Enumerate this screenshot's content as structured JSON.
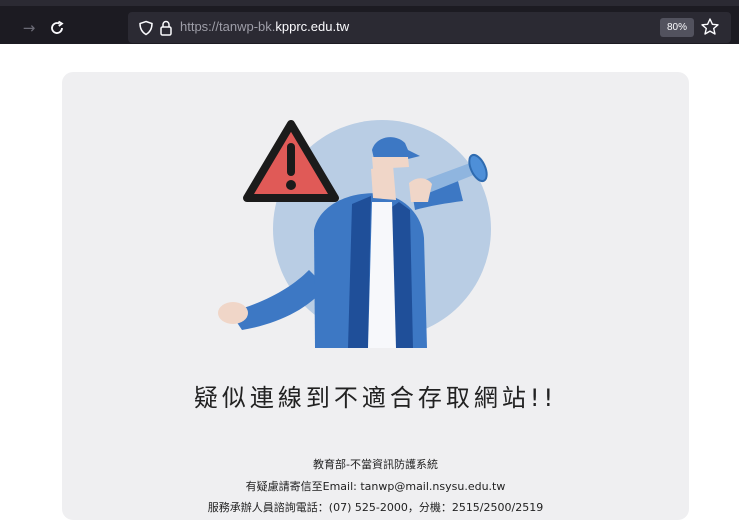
{
  "browser": {
    "url_prefix": "https://tanwp-bk.",
    "url_host": "kpprc.edu.tw",
    "zoom": "80%",
    "icons": [
      "forward-icon",
      "reload-icon",
      "shield-icon",
      "lock-icon",
      "bookmark-star-icon"
    ]
  },
  "page": {
    "headline": "疑似連線到不適合存取網站!!",
    "line1": "教育部-不當資訊防護系統",
    "line2": "有疑慮請寄信至Email: tanwp@mail.nsysu.edu.tw",
    "line3": "服務承辦人員諮詢電話：(07) 525-2000，分機：2515/2500/2519"
  },
  "colors": {
    "toolbar": "#1c1b22",
    "card": "#efeff1",
    "warning_red": "#e05a57",
    "jacket_blue": "#3d78c4",
    "circle_blue": "#b9cde4"
  }
}
